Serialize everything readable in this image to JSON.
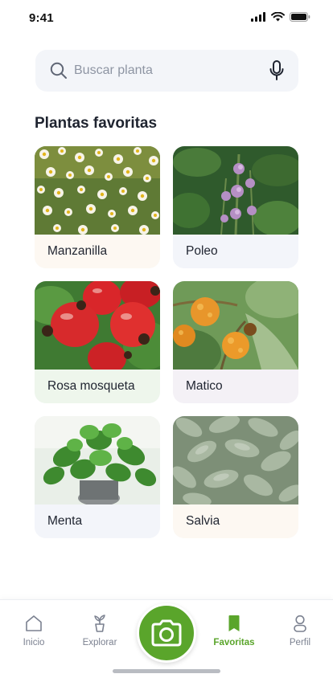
{
  "status_bar": {
    "time": "9:41"
  },
  "search": {
    "placeholder": "Buscar planta",
    "value": ""
  },
  "section": {
    "title": "Plantas favoritas"
  },
  "plants": [
    {
      "label": "Manzanilla",
      "label_bg": "#fdf8f2"
    },
    {
      "label": "Poleo",
      "label_bg": "#f3f5fa"
    },
    {
      "label": "Rosa mosqueta",
      "label_bg": "#eef6ec"
    },
    {
      "label": "Matico",
      "label_bg": "#f4f1f6"
    },
    {
      "label": "Menta",
      "label_bg": "#f3f5fa"
    },
    {
      "label": "Salvia",
      "label_bg": "#fdf8f2"
    }
  ],
  "nav": {
    "items": [
      {
        "label": "Inicio",
        "icon": "home-icon"
      },
      {
        "label": "Explorar",
        "icon": "plant-pot-icon"
      },
      {
        "label": "Favoritas",
        "icon": "bookmark-icon"
      },
      {
        "label": "Perfil",
        "icon": "person-icon"
      }
    ],
    "center_icon": "camera-icon",
    "active": "Favoritas"
  },
  "colors": {
    "accent": "#5aa52b",
    "text": "#1f2430",
    "muted": "#7b8190",
    "search_bg": "#f3f5f9"
  }
}
